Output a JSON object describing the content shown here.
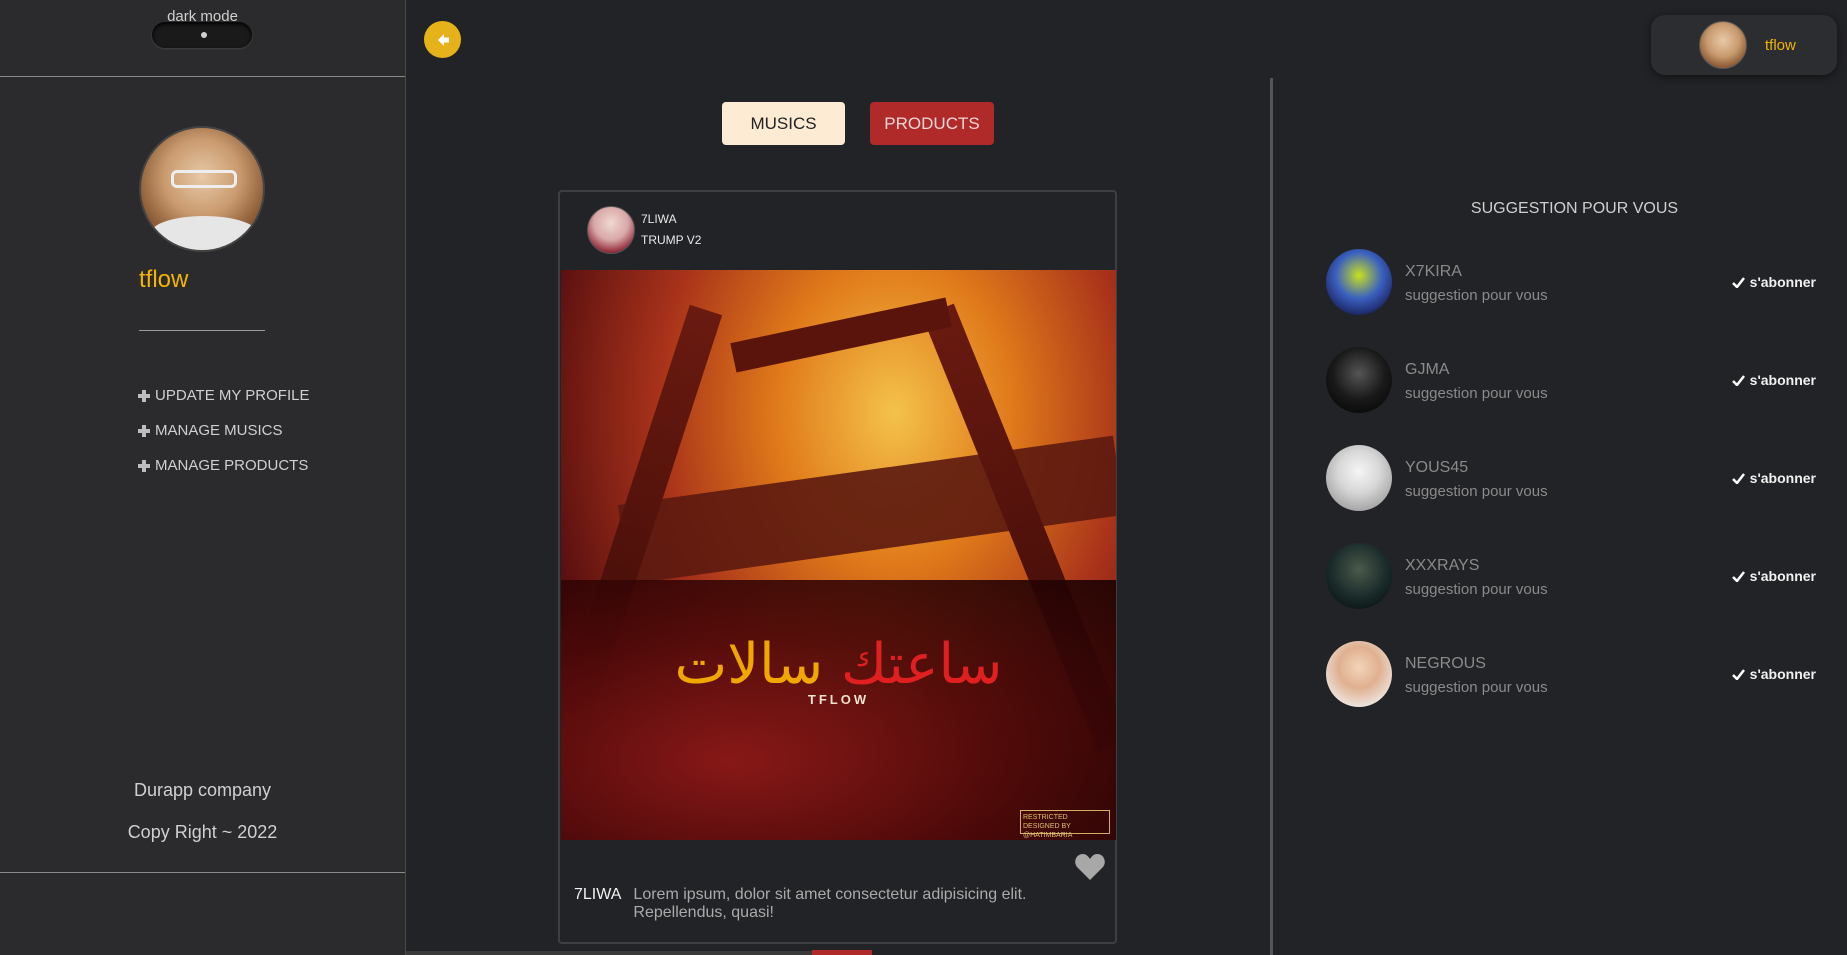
{
  "sidebar": {
    "dark_mode_label": "dark mode",
    "username": "tflow",
    "menu": [
      {
        "label": "UPDATE MY PROFILE"
      },
      {
        "label": "MANAGE MUSICS"
      },
      {
        "label": "MANAGE PRODUCTS"
      }
    ],
    "footer_company": "Durapp company",
    "footer_copyright": "Copy Right ~ 2022"
  },
  "header": {
    "user_name": "tflow"
  },
  "tabs": {
    "musics": "MUSICS",
    "products": "PRODUCTS"
  },
  "post": {
    "artist": "7LIWA",
    "track": "TRUMP V2",
    "cover_title_red": "ساعتك",
    "cover_title_yellow": "سالات",
    "cover_brand": "TFLOW",
    "cover_rating_text": "RESTRICTED",
    "cover_credit": "DESIGNED BY @HATIMBARIA",
    "caption_author": "7LIWA",
    "caption_text": "Lorem ipsum, dolor sit amet consectetur adipisicing elit. Repellendus, quasi!"
  },
  "suggestions": {
    "title": "SUGGESTION POUR VOUS",
    "follow_label": "s'abonner",
    "items": [
      {
        "name": "X7KIRA",
        "subtitle": "suggestion pour vous"
      },
      {
        "name": "GJMA",
        "subtitle": "suggestion pour vous"
      },
      {
        "name": "YOUS45",
        "subtitle": "suggestion pour vous"
      },
      {
        "name": "XXXRAYS",
        "subtitle": "suggestion pour vous"
      },
      {
        "name": "NEGROUS",
        "subtitle": "suggestion pour vous"
      }
    ]
  },
  "colors": {
    "accent": "#f4b400",
    "products_tab": "#b02a2a",
    "musics_tab": "#fdebd3",
    "background": "#222327",
    "sidebar": "#2b2b2d"
  }
}
